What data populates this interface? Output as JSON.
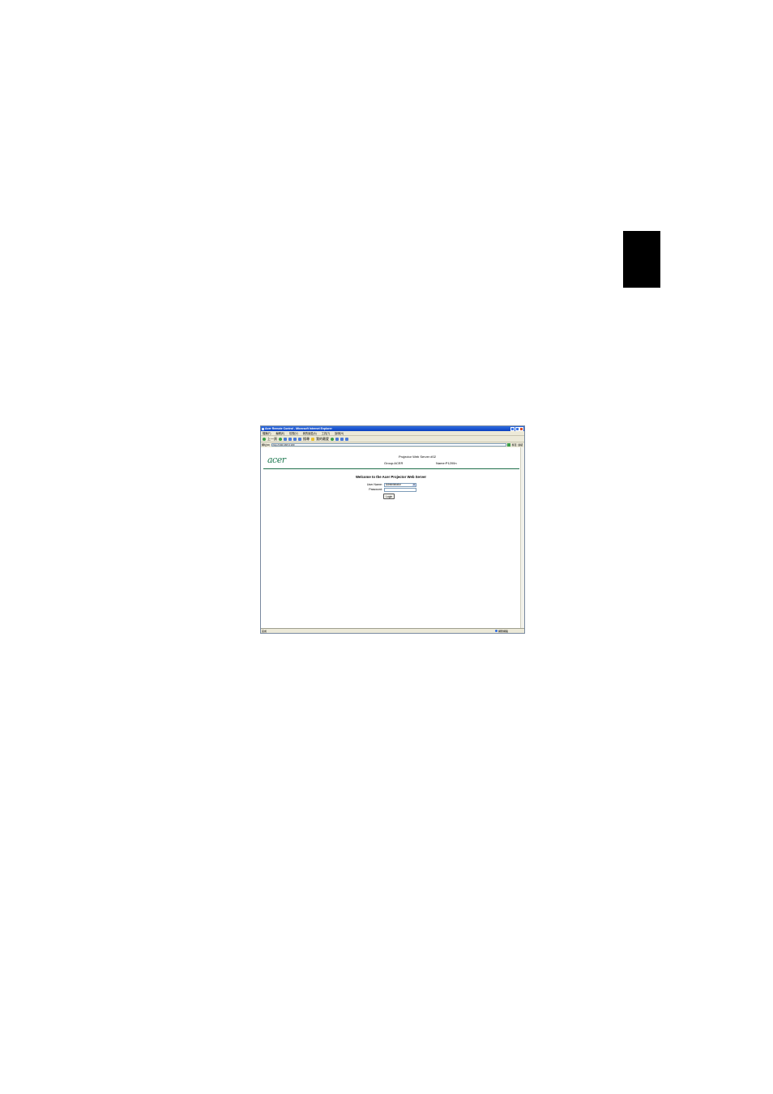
{
  "browser": {
    "title": "Acer Remote Control - Microsoft Internet Explorer",
    "menu": [
      "檔案(F)",
      "編輯(E)",
      "檢視(V)",
      "我的最愛(A)",
      "工具(T)",
      "說明(H)"
    ],
    "toolbar": {
      "back_label": "上一頁",
      "search_label": "搜尋",
      "favorites_label": "我的最愛"
    },
    "address": {
      "label": "網址(D)",
      "value": "http://192.168.0.100",
      "go_label": "移至",
      "links_label": "連結"
    },
    "status": {
      "left": "完成",
      "zone": "網際網路"
    }
  },
  "page": {
    "logo": "acer",
    "server_title": "Projector Web Server #02",
    "group": "Group:ACER",
    "name": "Name:P1200n",
    "welcome": "Welcome to the Acer Projector Web Server",
    "user_label": "User Name:",
    "user_value": "Administrator",
    "password_label": "Password:",
    "login_label": "Login"
  }
}
